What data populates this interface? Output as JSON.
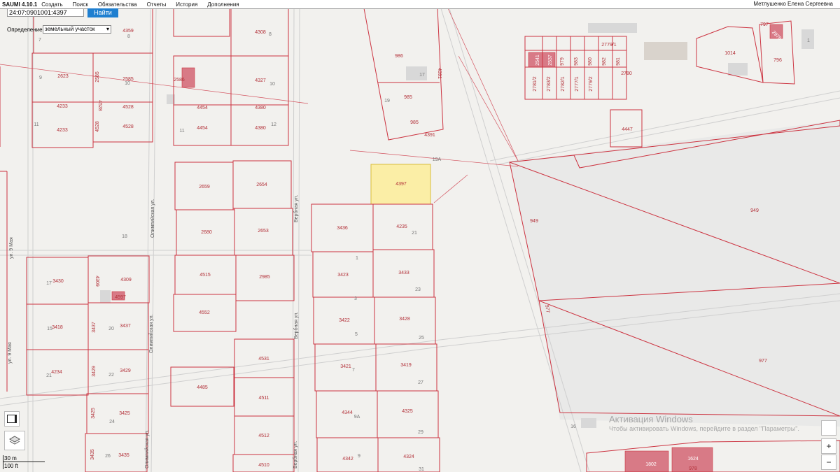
{
  "app": {
    "title": "SAUMI 4.10.1",
    "user": "Метлушенко Елена Сергеевна"
  },
  "menu": [
    "Создать",
    "Поиск",
    "Обязательства",
    "Отчеты",
    "История",
    "Дополнения"
  ],
  "search": {
    "value": "24:07:0901001:4397",
    "button": "Найти"
  },
  "definition": {
    "label": "Определение:",
    "value": "земельный участок"
  },
  "scale": {
    "meters": "30 m",
    "feet": "100 ft"
  },
  "windows_activation": {
    "title": "Активация Windows",
    "subtitle": "Чтобы активировать Windows, перейдите в раздел \"Параметры\"."
  },
  "colors": {
    "parcel_border": "#cc3340",
    "parcel_label": "#b23038",
    "highlight_fill": "#fbeea6",
    "highlight_border": "#d8bd3c",
    "building": "#d87a86",
    "road": "#d8d8d8"
  },
  "icons": {
    "layers": "layers-icon",
    "basemap": "basemap-icon",
    "zoom_in": "plus-icon",
    "zoom_out": "minus-icon"
  },
  "highlighted": "4397",
  "streets": [
    "ул. 9 Мая",
    "Олимпийская ул.",
    "Вербная ул."
  ],
  "parcels": [
    "4359",
    "4308",
    "986",
    "4391",
    "2779/1",
    "1014",
    "797",
    "796",
    "2623",
    "2585",
    "2585",
    "2586",
    "4327",
    "985",
    "985",
    "2781/2",
    "2783/2",
    "2782/1",
    "2777/1",
    "2779/2",
    "2780",
    "4233",
    "4528",
    "4528",
    "4454",
    "4380",
    "4233",
    "4528",
    "4528",
    "4454",
    "4380",
    "4391",
    "4447",
    "2659",
    "2654",
    "4397",
    "2680",
    "2653",
    "3436",
    "4235",
    "949",
    "949",
    "4515",
    "2985",
    "3423",
    "3433",
    "3430",
    "4309",
    "4597",
    "4552",
    "3422",
    "3428",
    "3418",
    "3437",
    "3437",
    "3421",
    "3419",
    "4234",
    "3429",
    "3429",
    "4531",
    "4485",
    "4511",
    "4344",
    "4325",
    "3425",
    "3425",
    "4512",
    "4342",
    "4324",
    "3435",
    "3435",
    "4510",
    "977",
    "977",
    "1802",
    "1624",
    "978"
  ],
  "numbers": [
    "7",
    "8",
    "8",
    "17",
    "9",
    "10",
    "19",
    "11",
    "12",
    "11",
    "18",
    "21",
    "1",
    "23",
    "17",
    "20",
    "3",
    "5",
    "25",
    "15",
    "7",
    "27",
    "21",
    "22",
    "24",
    "9A",
    "29",
    "26",
    "9",
    "31",
    "16",
    "1",
    "19A"
  ]
}
